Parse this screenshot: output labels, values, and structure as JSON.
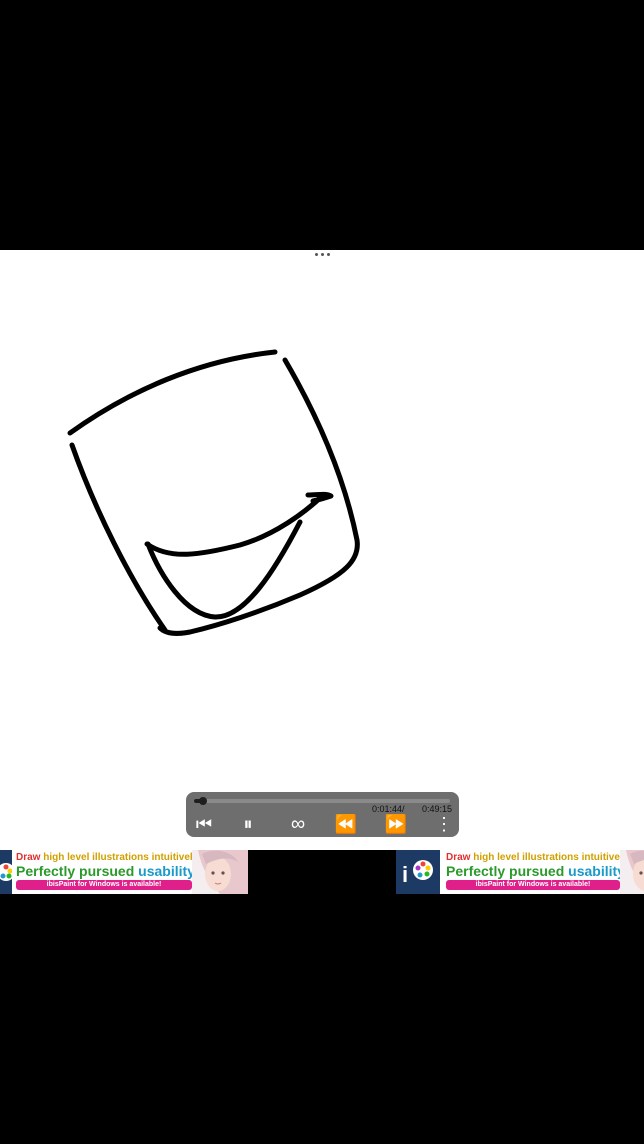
{
  "player": {
    "current_time": "0:01:44/",
    "total_time": "0:49:15",
    "progress": 0.035,
    "icons": [
      "skip-to-start-icon",
      "pause-icon",
      "loop-icon",
      "rewind-icon",
      "fast-forward-icon",
      "more-vertical-icon"
    ],
    "glyphs": {
      "skip": "⏮",
      "pause": "⏸",
      "loop": "∞",
      "rewind": "⏪",
      "forward": "⏩",
      "more": "⋮"
    }
  },
  "ads": [
    {
      "line1_a": "Draw",
      "line1_b": "high level illustrations intuitively!",
      "line2_a": "Perfectly pursued",
      "line2_b": "usability!",
      "bar": "ibisPaint for Windows is available!"
    },
    {
      "line1_a": "Draw",
      "line1_b": "high level illustrations intuitively!",
      "line2_a": "Perfectly pursued",
      "line2_b": "usability!",
      "bar": "ibisPaint for Windows is available!"
    }
  ],
  "colors": {
    "player_bg": "#6e6e6e",
    "stroke": "#000000",
    "ad_pink": "#e0208a"
  }
}
